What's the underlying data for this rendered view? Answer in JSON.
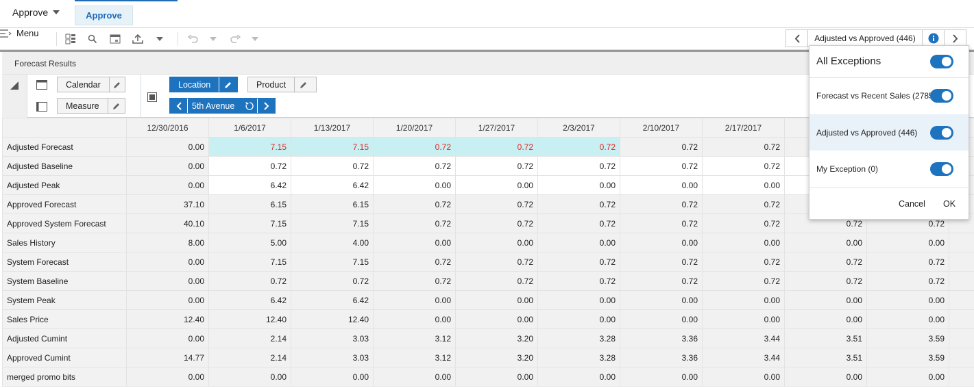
{
  "topbar": {
    "app_name": "Approve",
    "active_tab": "Approve"
  },
  "toolbar": {
    "menu_label": "Menu",
    "exception_nav_label": "Adjusted vs Approved (446)"
  },
  "panel": {
    "title": "Forecast Results"
  },
  "pivot": {
    "calendar_label": "Calendar",
    "measure_label": "Measure",
    "location_label": "Location",
    "product_label": "Product",
    "location_value": "5th Avenue"
  },
  "grid": {
    "columns": [
      "12/30/2016",
      "1/6/2017",
      "1/13/2017",
      "1/20/2017",
      "1/27/2017",
      "2/3/2017",
      "2/10/2017",
      "2/17/2017",
      "",
      ""
    ],
    "rows": [
      {
        "label": "Adjusted Forecast",
        "values": [
          "0.00",
          "7.15",
          "7.15",
          "0.72",
          "0.72",
          "0.72",
          "0.72",
          "0.72",
          "",
          ""
        ]
      },
      {
        "label": "Adjusted Baseline",
        "values": [
          "0.00",
          "0.72",
          "0.72",
          "0.72",
          "0.72",
          "0.72",
          "0.72",
          "0.72",
          "",
          ""
        ]
      },
      {
        "label": "Adjusted Peak",
        "values": [
          "0.00",
          "6.42",
          "6.42",
          "0.00",
          "0.00",
          "0.00",
          "0.00",
          "0.00",
          "",
          ""
        ]
      },
      {
        "label": "Approved Forecast",
        "values": [
          "37.10",
          "6.15",
          "6.15",
          "0.72",
          "0.72",
          "0.72",
          "0.72",
          "0.72",
          "",
          ""
        ]
      },
      {
        "label": "Approved System Forecast",
        "values": [
          "40.10",
          "7.15",
          "7.15",
          "0.72",
          "0.72",
          "0.72",
          "0.72",
          "0.72",
          "0.72",
          "0.72"
        ]
      },
      {
        "label": "Sales History",
        "values": [
          "8.00",
          "5.00",
          "4.00",
          "0.00",
          "0.00",
          "0.00",
          "0.00",
          "0.00",
          "0.00",
          "0.00"
        ]
      },
      {
        "label": "System Forecast",
        "values": [
          "0.00",
          "7.15",
          "7.15",
          "0.72",
          "0.72",
          "0.72",
          "0.72",
          "0.72",
          "0.72",
          "0.72"
        ]
      },
      {
        "label": "System Baseline",
        "values": [
          "0.00",
          "0.72",
          "0.72",
          "0.72",
          "0.72",
          "0.72",
          "0.72",
          "0.72",
          "0.72",
          "0.72"
        ]
      },
      {
        "label": "System Peak",
        "values": [
          "0.00",
          "6.42",
          "6.42",
          "0.00",
          "0.00",
          "0.00",
          "0.00",
          "0.00",
          "0.00",
          "0.00"
        ]
      },
      {
        "label": "Sales Price",
        "values": [
          "12.40",
          "12.40",
          "12.40",
          "0.00",
          "0.00",
          "0.00",
          "0.00",
          "0.00",
          "0.00",
          "0.00"
        ]
      },
      {
        "label": "Adjusted Cumint",
        "values": [
          "0.00",
          "2.14",
          "3.03",
          "3.12",
          "3.20",
          "3.28",
          "3.36",
          "3.44",
          "3.51",
          "3.59"
        ]
      },
      {
        "label": "Approved Cumint",
        "values": [
          "14.77",
          "2.14",
          "3.03",
          "3.12",
          "3.20",
          "3.28",
          "3.36",
          "3.44",
          "3.51",
          "3.59"
        ]
      },
      {
        "label": "merged promo bits",
        "values": [
          "0.00",
          "0.00",
          "0.00",
          "0.00",
          "0.00",
          "0.00",
          "0.00",
          "0.00",
          "0.00",
          "0.00"
        ]
      }
    ]
  },
  "exceptions_popup": {
    "title": "All Exceptions",
    "items": [
      {
        "label": "Forecast vs Recent Sales (2785)",
        "on": true
      },
      {
        "label": "Adjusted vs Approved (446)",
        "on": true
      },
      {
        "label": "My Exception (0)",
        "on": true
      }
    ],
    "all_on": true,
    "cancel_label": "Cancel",
    "ok_label": "OK"
  },
  "colors": {
    "accent": "#1e73be",
    "highlight_cell": "#c8eff1",
    "exception_text": "#e02a2a"
  }
}
